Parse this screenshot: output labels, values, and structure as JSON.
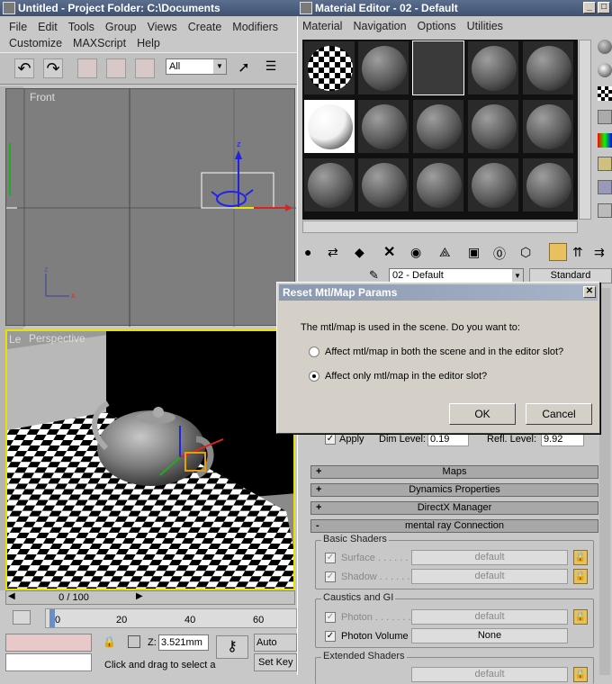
{
  "main_window": {
    "title": "Untitled - Project Folder: C:\\Documents",
    "menu": [
      "File",
      "Edit",
      "Tools",
      "Group",
      "Views",
      "Create",
      "Modifiers",
      "Customize",
      "MAXScript",
      "Help"
    ],
    "selection_filter": "All"
  },
  "viewports": {
    "front_label": "Front",
    "perspective_label": "Perspective",
    "side_label": "Le"
  },
  "timeline": {
    "frame_counter": "0 / 100",
    "ticks": [
      "0",
      "20",
      "40",
      "60"
    ]
  },
  "status": {
    "z_label": "Z:",
    "z_value": "3.521mm",
    "prompt": "Click and drag to select a",
    "auto_key": "Auto Key",
    "set_key": "Set Key"
  },
  "material_editor": {
    "title": "Material Editor - 02 - Default",
    "menu": [
      "Material",
      "Navigation",
      "Options",
      "Utilities"
    ],
    "material_name": "02 - Default",
    "material_type": "Standard",
    "apply_label": "Apply",
    "dim_level_label": "Dim Level:",
    "dim_level_value": "0.19",
    "refl_level_label": "Refl. Level:",
    "refl_level_value": "9.92",
    "rollouts": [
      {
        "sign": "+",
        "label": "Maps"
      },
      {
        "sign": "+",
        "label": "Dynamics Properties"
      },
      {
        "sign": "+",
        "label": "DirectX Manager"
      },
      {
        "sign": "-",
        "label": "mental ray Connection"
      }
    ],
    "basic_shaders": {
      "title": "Basic Shaders",
      "surface_label": "Surface . . . . . .",
      "surface_value": "default",
      "shadow_label": "Shadow . . . . . .",
      "shadow_value": "default"
    },
    "caustics": {
      "title": "Caustics and GI",
      "photon_label": "Photon . . . . . . .",
      "photon_value": "default",
      "photon_volume_label": "Photon Volume",
      "photon_volume_value": "None"
    },
    "extended_shaders": {
      "title": "Extended Shaders",
      "displacement_value": "default"
    }
  },
  "dialog": {
    "title": "Reset Mtl/Map Params",
    "question": "The mtl/map is used in the scene. Do you want to:",
    "option_both": "Affect mtl/map in both the scene and in the editor slot?",
    "option_slot": "Affect only mtl/map in the editor slot?",
    "selected": "option_slot",
    "ok_label": "OK",
    "cancel_label": "Cancel"
  }
}
